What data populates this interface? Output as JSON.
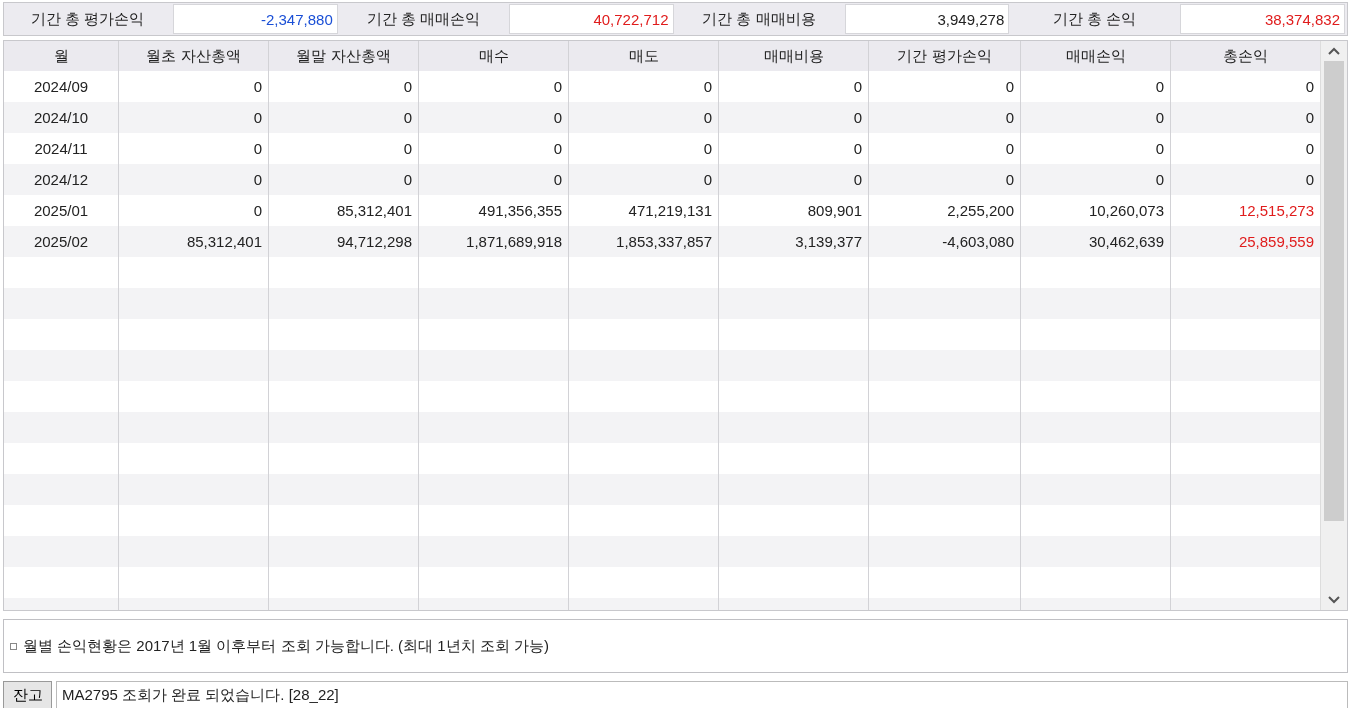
{
  "summary": [
    {
      "label": "기간 총 평가손익",
      "value": "-2,347,880",
      "color": "#1a4fd6"
    },
    {
      "label": "기간 총 매매손익",
      "value": "40,722,712",
      "color": "#e01c1c"
    },
    {
      "label": "기간 총 매매비용",
      "value": "3,949,278",
      "color": "#222222"
    },
    {
      "label": "기간 총 손익",
      "value": "38,374,832",
      "color": "#e01c1c"
    }
  ],
  "table": {
    "columns": [
      "월",
      "월초 자산총액",
      "월말 자산총액",
      "매수",
      "매도",
      "매매비용",
      "기간 평가손익",
      "매매손익",
      "총손익"
    ],
    "rows": [
      {
        "cells": [
          "2024/09",
          "0",
          "0",
          "0",
          "0",
          "0",
          "0",
          "0",
          "0"
        ],
        "color": "#222222"
      },
      {
        "cells": [
          "2024/10",
          "0",
          "0",
          "0",
          "0",
          "0",
          "0",
          "0",
          "0"
        ],
        "color": "#222222"
      },
      {
        "cells": [
          "2024/11",
          "0",
          "0",
          "0",
          "0",
          "0",
          "0",
          "0",
          "0"
        ],
        "color": "#222222"
      },
      {
        "cells": [
          "2024/12",
          "0",
          "0",
          "0",
          "0",
          "0",
          "0",
          "0",
          "0"
        ],
        "color": "#222222"
      },
      {
        "cells": [
          "2025/01",
          "0",
          "85,312,401",
          "491,356,355",
          "471,219,131",
          "809,901",
          "2,255,200",
          "10,260,073",
          "12,515,273"
        ],
        "color": "#e01c1c"
      },
      {
        "cells": [
          "2025/02",
          "85,312,401",
          "94,712,298",
          "1,871,689,918",
          "1,853,337,857",
          "3,139,377",
          "-4,603,080",
          "30,462,639",
          "25,859,559"
        ],
        "color": "#e01c1c"
      }
    ]
  },
  "notice": "월별 손익현황은 2017년 1월 이후부터 조회 가능합니다. (최대 1년치 조회 가능)",
  "status_bar": {
    "button": "잔고",
    "message": "MA2795 조회가 완료 되었습니다. [28_22]"
  }
}
